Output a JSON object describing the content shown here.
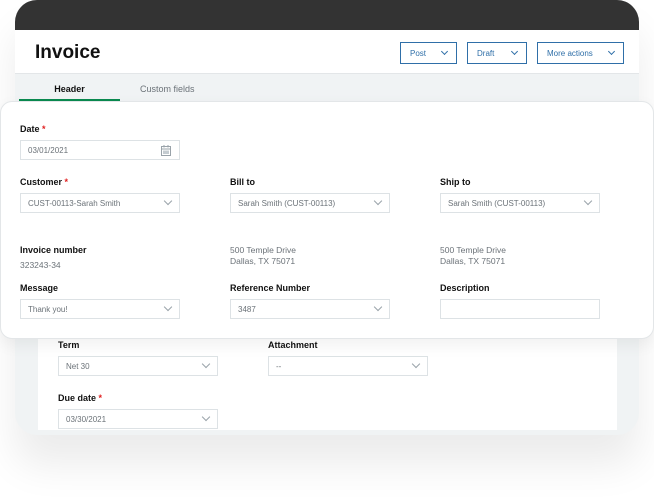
{
  "header": {
    "title": "Invoice",
    "buttons": [
      {
        "label": "Post"
      },
      {
        "label": "Draft"
      },
      {
        "label": "More actions"
      }
    ]
  },
  "tabs": [
    {
      "label": "Header",
      "active": true
    },
    {
      "label": "Custom fields",
      "active": false
    }
  ],
  "colors": {
    "accent": "#2f6fa8",
    "tab_active": "#0a8a4f",
    "required": "#e02020",
    "topbar": "#333333"
  },
  "form": {
    "date": {
      "label": "Date",
      "required_mark": "*",
      "value": "03/01/2021",
      "icon": "calendar-icon"
    },
    "customer": {
      "label": "Customer",
      "required_mark": "*",
      "value": "CUST-00113-Sarah Smith"
    },
    "bill_to": {
      "label": "Bill to",
      "value": "Sarah Smith (CUST-00113)",
      "address1": "500 Temple Drive",
      "address2": "Dallas, TX 75071"
    },
    "ship_to": {
      "label": "Ship to",
      "value": "Sarah Smith (CUST-00113)",
      "address1": "500 Temple Drive",
      "address2": "Dallas, TX 75071"
    },
    "invoice_number": {
      "label": "Invoice number",
      "value": "323243-34"
    },
    "message": {
      "label": "Message",
      "value": "Thank you!"
    },
    "reference_number": {
      "label": "Reference Number",
      "value": "3487"
    },
    "description": {
      "label": "Description",
      "value": ""
    },
    "term": {
      "label": "Term",
      "value": "Net 30"
    },
    "attachment": {
      "label": "Attachment",
      "value": "--"
    },
    "due_date": {
      "label": "Due date",
      "required_mark": "*",
      "value": "03/30/2021"
    }
  }
}
